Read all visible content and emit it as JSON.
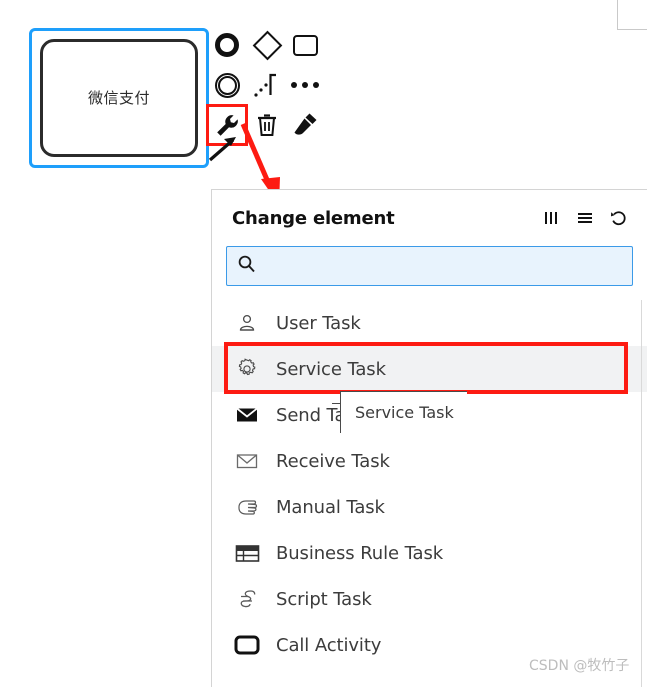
{
  "diagram": {
    "task": {
      "label": "微信支付",
      "selected": true,
      "selection_color": "#1e9ffb",
      "stroke_color": "#2b2b2b"
    },
    "context_pad": {
      "icons": [
        {
          "name": "append-end-event-icon",
          "title": "Append EndEvent"
        },
        {
          "name": "append-gateway-icon",
          "title": "Append Gateway"
        },
        {
          "name": "append-task-icon",
          "title": "Append Task"
        },
        {
          "name": "append-intermediate-event-icon",
          "title": "Append Intermediate Event"
        },
        {
          "name": "connect-icon",
          "title": "Connect"
        },
        {
          "name": "more-options-icon",
          "title": "More"
        },
        {
          "name": "wrench-icon",
          "title": "Change element"
        },
        {
          "name": "trash-icon",
          "title": "Remove"
        },
        {
          "name": "brush-icon",
          "title": "Set color"
        }
      ],
      "highlight_color": "#fd1b12"
    },
    "annotation_arrow_color": "#fd1b12"
  },
  "panel": {
    "title": "Change element",
    "header_icons": [
      {
        "name": "columns-icon",
        "glyph": "|||"
      },
      {
        "name": "list-icon",
        "glyph": "≡"
      },
      {
        "name": "refresh-icon",
        "glyph": "↺"
      }
    ],
    "search": {
      "value": "",
      "placeholder": "",
      "icon": "search-icon",
      "background": "#e8f3fd",
      "border": "#3b9ae8"
    },
    "items": [
      {
        "icon": "user-task-icon",
        "label": "User Task",
        "selected": false
      },
      {
        "icon": "service-task-icon",
        "label": "Service Task",
        "selected": true
      },
      {
        "icon": "send-task-icon",
        "label": "Send Task",
        "selected": false
      },
      {
        "icon": "receive-task-icon",
        "label": "Receive Task",
        "selected": false
      },
      {
        "icon": "manual-task-icon",
        "label": "Manual Task",
        "selected": false
      },
      {
        "icon": "business-rule-task-icon",
        "label": "Business Rule Task",
        "selected": false
      },
      {
        "icon": "script-task-icon",
        "label": "Script Task",
        "selected": false
      },
      {
        "icon": "call-activity-icon",
        "label": "Call Activity",
        "selected": false
      }
    ],
    "highlight_box_color": "#fd1b12",
    "selected_row_background": "#f1f2f3"
  },
  "tooltip": {
    "text": "Service Task"
  },
  "watermark": {
    "text": "CSDN @牧竹子"
  }
}
